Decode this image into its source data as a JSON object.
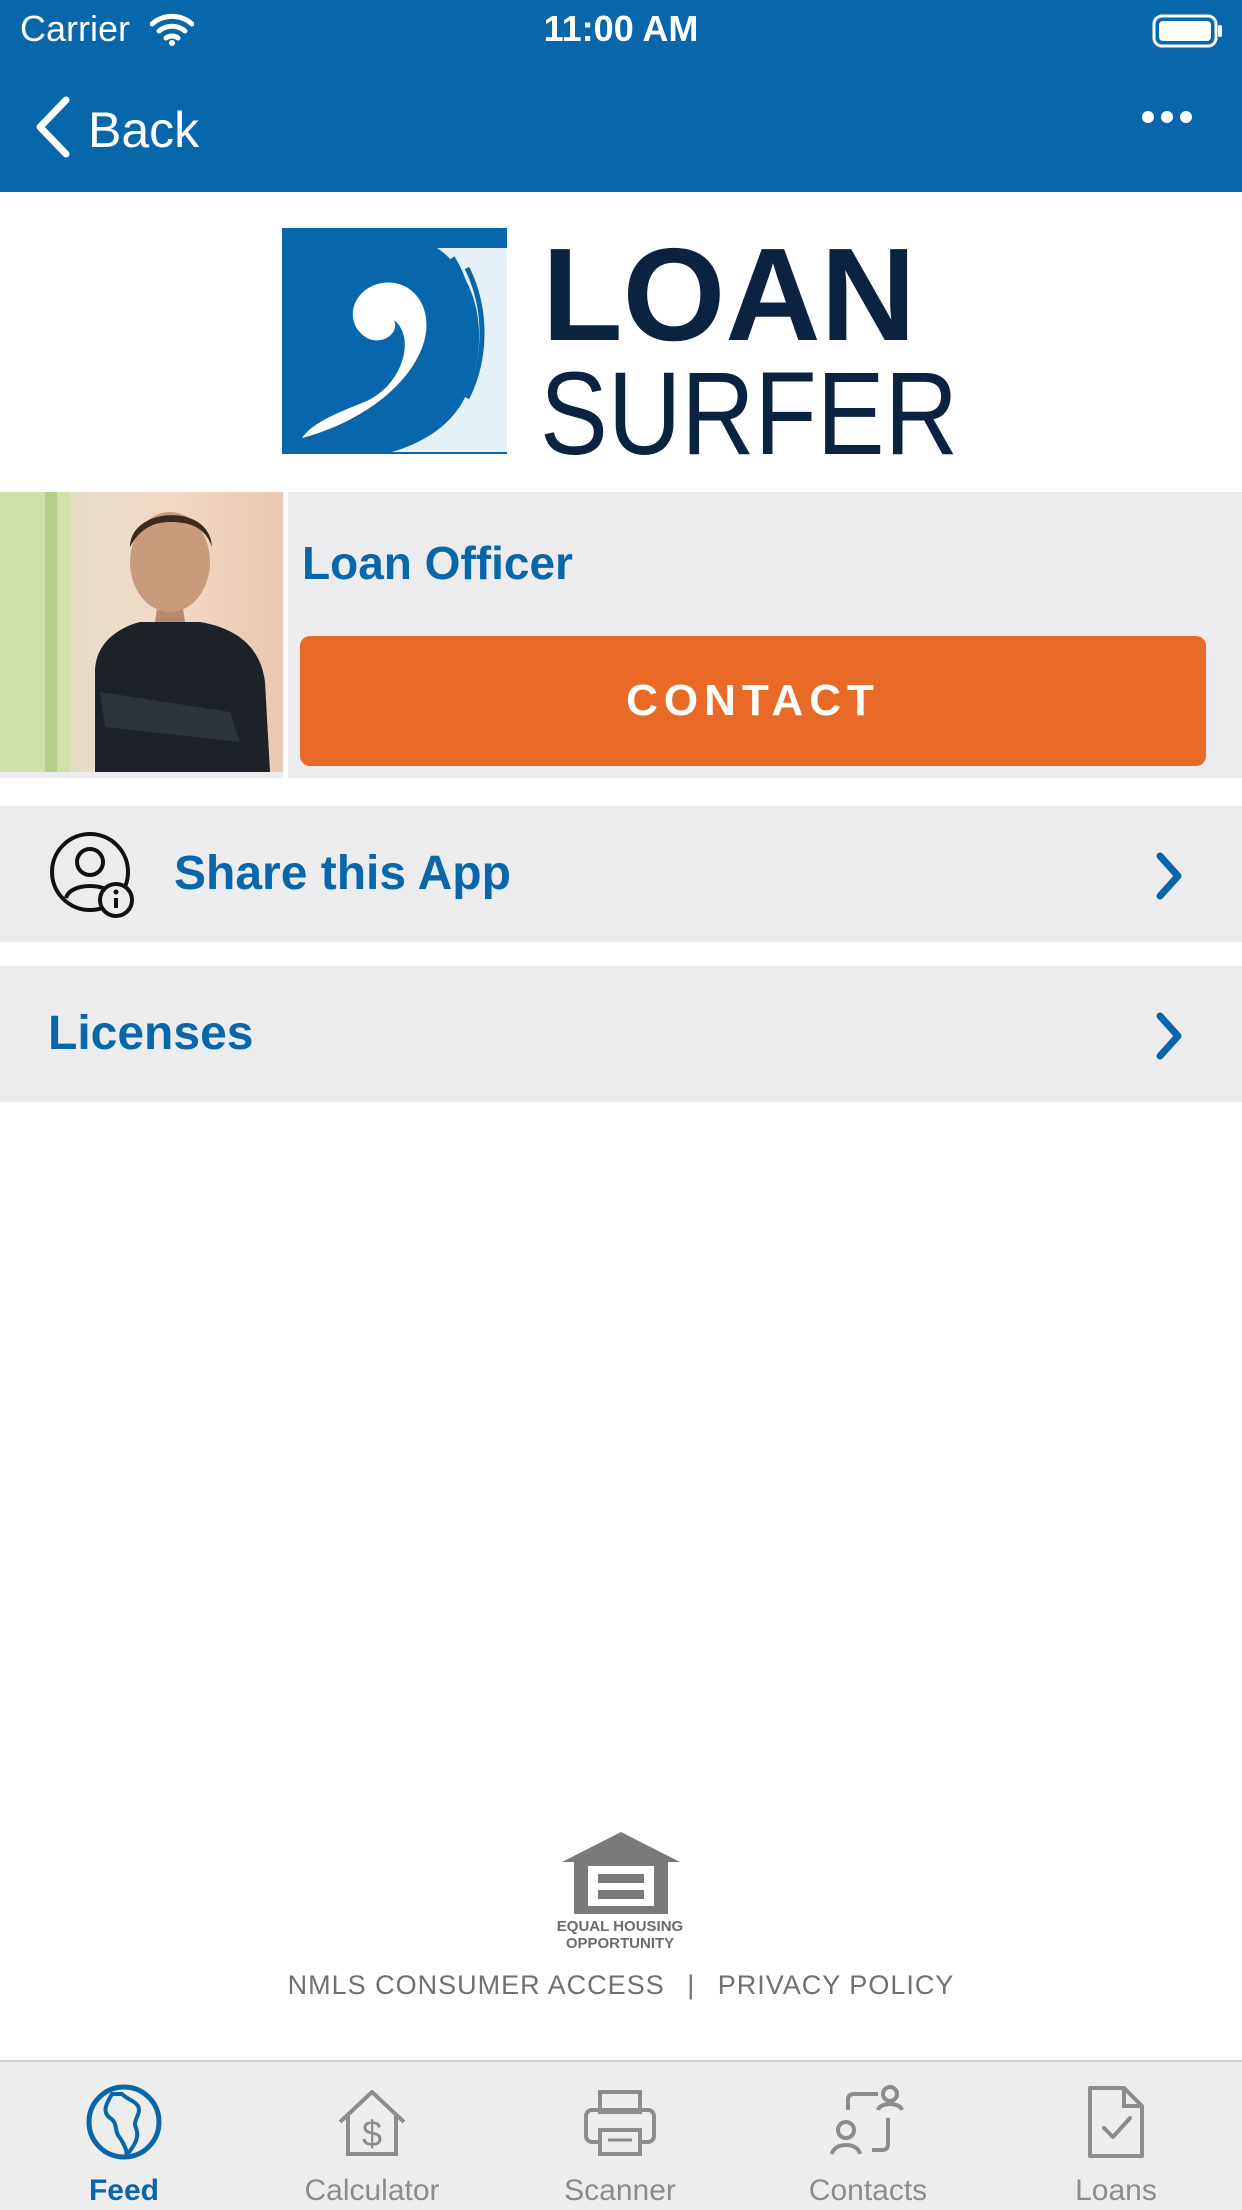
{
  "status_bar": {
    "carrier": "Carrier",
    "time": "11:00 AM"
  },
  "nav": {
    "back_label": "Back",
    "more_icon": "more-horizontal-icon"
  },
  "brand": {
    "logo_line1": "LOAN",
    "logo_line2": "SURFER",
    "primary_color": "#0866AA",
    "navy_color": "#0B2240",
    "accent_color": "#E86A26"
  },
  "profile": {
    "title": "Loan Officer",
    "contact_label": "CONTACT"
  },
  "rows": [
    {
      "label": "Share this App",
      "icon": "user-info-icon"
    },
    {
      "label": "Licenses"
    }
  ],
  "footer": {
    "eho_line1": "EQUAL HOUSING",
    "eho_line2": "OPPORTUNITY",
    "nmls_link": "NMLS CONSUMER ACCESS",
    "separator": "|",
    "privacy_link": "PRIVACY POLICY"
  },
  "tabs": [
    {
      "label": "Feed",
      "icon": "globe-icon",
      "active": true
    },
    {
      "label": "Calculator",
      "icon": "house-dollar-icon",
      "active": false
    },
    {
      "label": "Scanner",
      "icon": "printer-icon",
      "active": false
    },
    {
      "label": "Contacts",
      "icon": "contacts-icon",
      "active": false
    },
    {
      "label": "Loans",
      "icon": "document-check-icon",
      "active": false
    }
  ]
}
